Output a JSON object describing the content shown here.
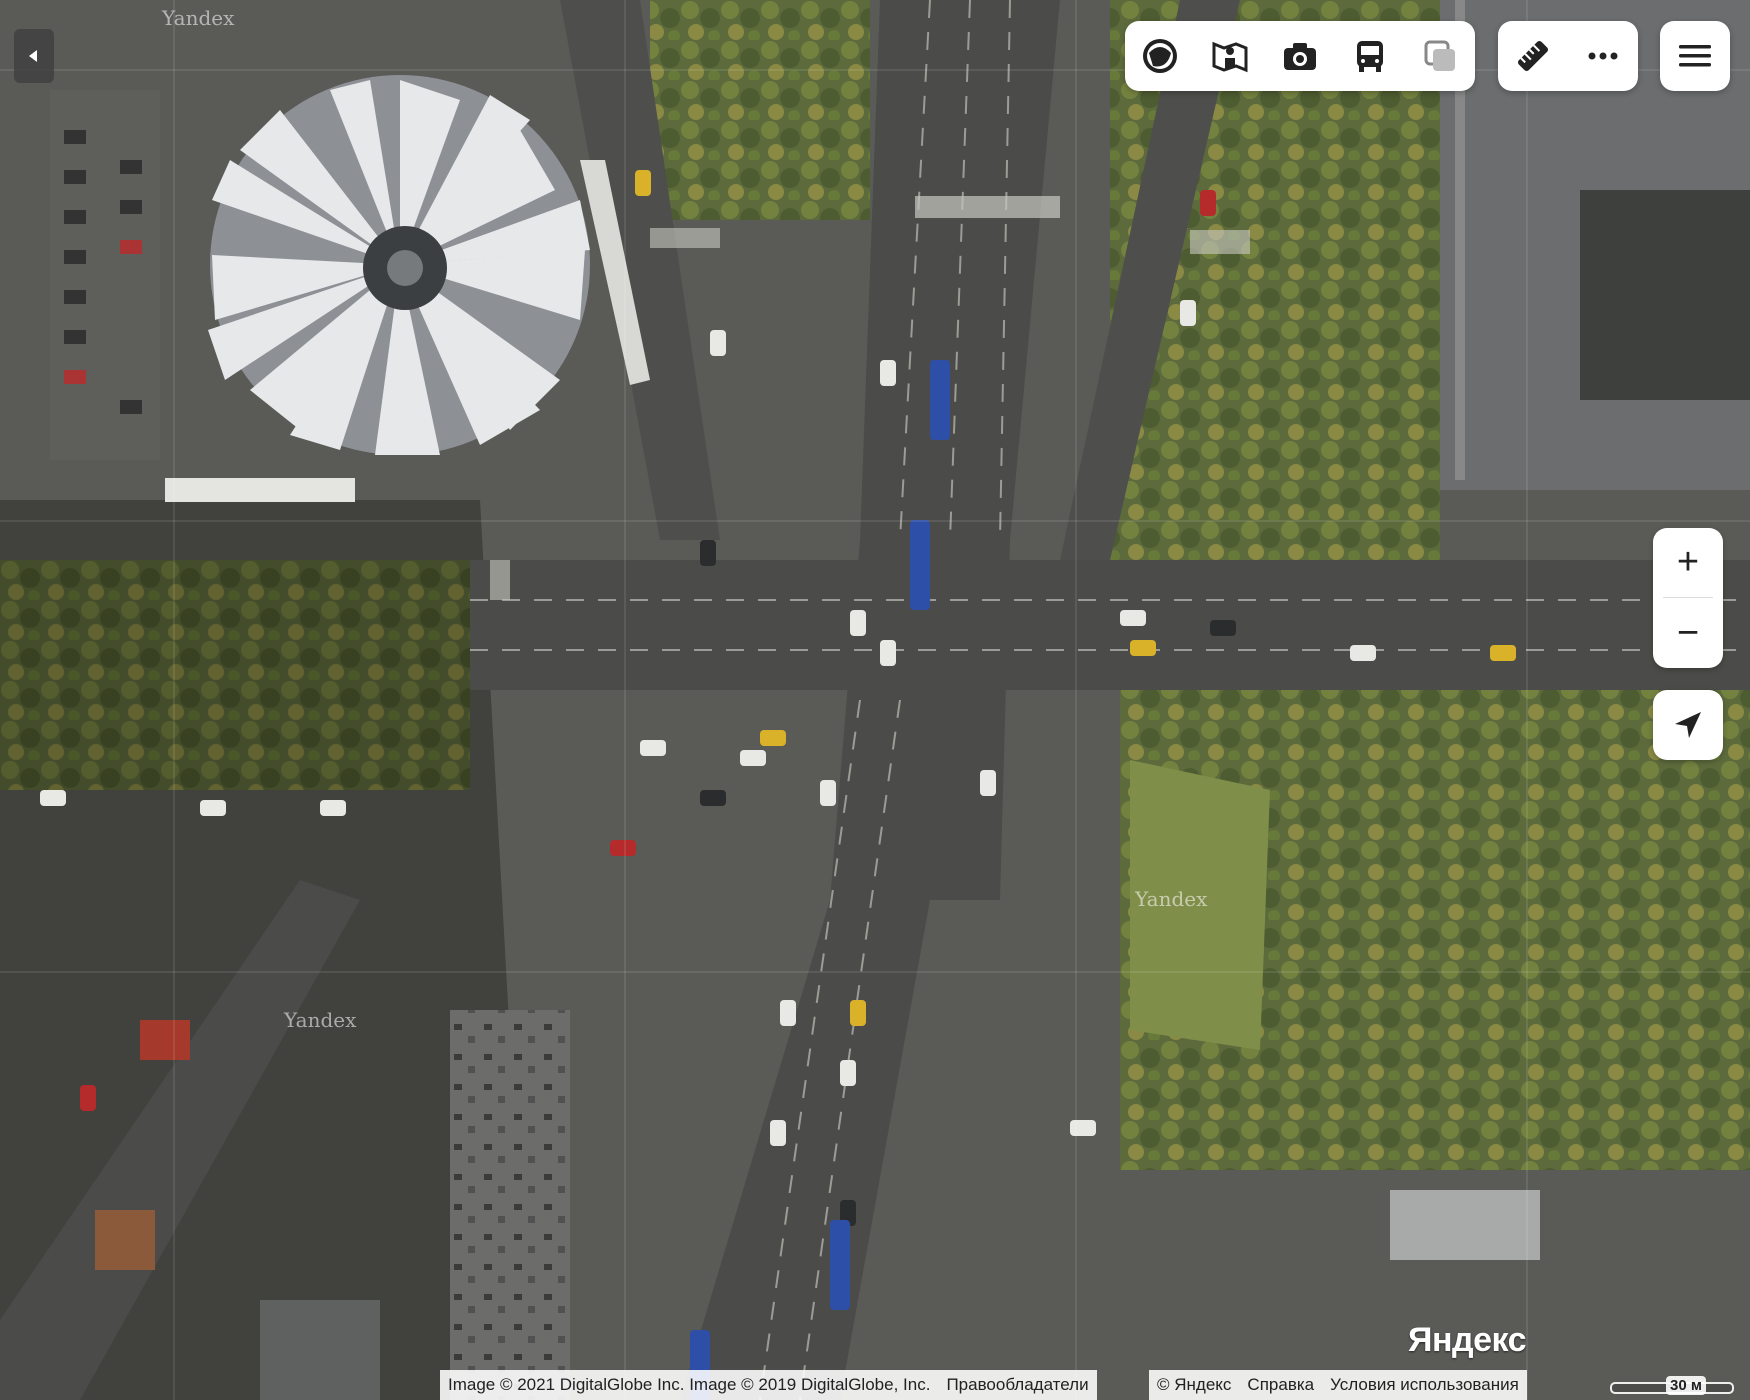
{
  "toolbar": {
    "layers": [
      "map-layers-icon",
      "panorama-icon",
      "photo-icon",
      "transit-icon",
      "overlay-icon"
    ],
    "tools": [
      "ruler-icon",
      "more-icon"
    ],
    "menu": "menu-icon"
  },
  "zoom": {
    "in_label": "+",
    "out_label": "−"
  },
  "attribution": {
    "imagery": "Image © 2021 DigitalGlobe Inc. Image © 2019 DigitalGlobe, Inc.",
    "rights": "Правообладатели",
    "copyright": "© Яндекс",
    "help": "Справка",
    "terms": "Условия использования"
  },
  "logo": "Яндекс",
  "scale_label": "30 м",
  "watermark": "Yandex"
}
